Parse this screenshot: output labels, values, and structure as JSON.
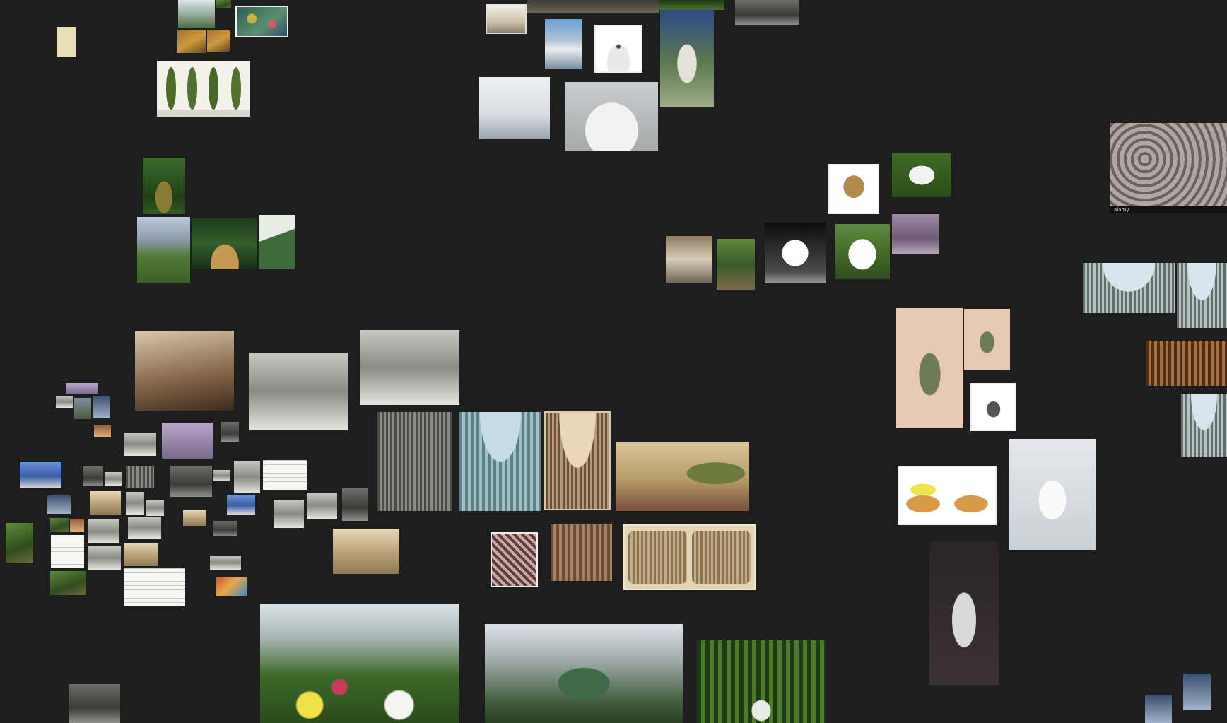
{
  "app": {
    "view": "image-similarity-map"
  },
  "thumbnails": {
    "ornament_watermark": "alamy"
  }
}
